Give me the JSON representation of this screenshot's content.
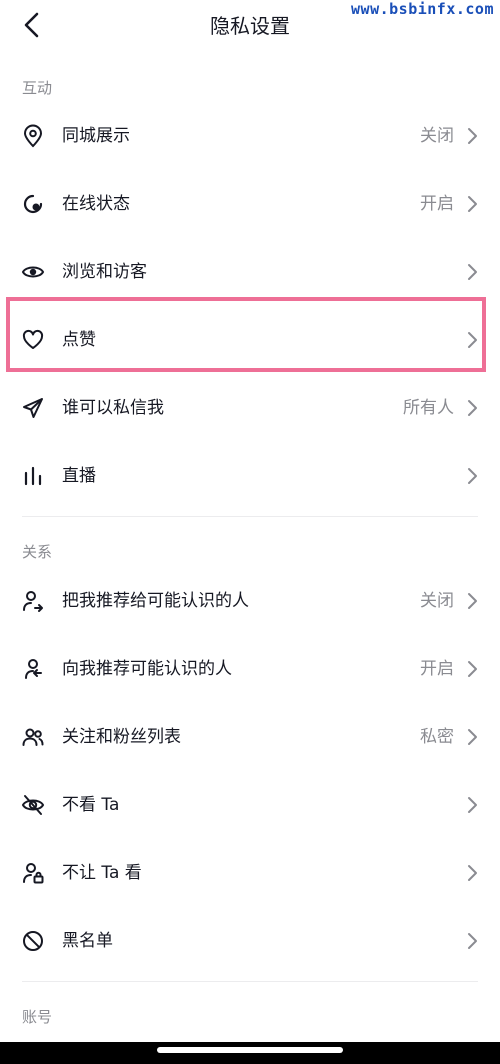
{
  "watermark": "www.bsbinfx.com",
  "header": {
    "title": "隐私设置"
  },
  "sections": [
    {
      "title": "互动",
      "items": [
        {
          "label": "同城展示",
          "value": "关闭",
          "icon": "location-pin-icon"
        },
        {
          "label": "在线状态",
          "value": "开启",
          "icon": "online-status-icon"
        },
        {
          "label": "浏览和访客",
          "value": "",
          "icon": "eye-icon"
        },
        {
          "label": "点赞",
          "value": "",
          "icon": "heart-icon"
        },
        {
          "label": "谁可以私信我",
          "value": "所有人",
          "icon": "send-icon"
        },
        {
          "label": "直播",
          "value": "",
          "icon": "live-bars-icon"
        }
      ]
    },
    {
      "title": "关系",
      "items": [
        {
          "label": "把我推荐给可能认识的人",
          "value": "关闭",
          "icon": "user-share-icon"
        },
        {
          "label": "向我推荐可能认识的人",
          "value": "开启",
          "icon": "user-recommend-icon"
        },
        {
          "label": "关注和粉丝列表",
          "value": "私密",
          "icon": "users-icon"
        },
        {
          "label": "不看 Ta",
          "value": "",
          "icon": "eye-off-icon"
        },
        {
          "label": "不让 Ta 看",
          "value": "",
          "icon": "user-lock-icon"
        },
        {
          "label": "黑名单",
          "value": "",
          "icon": "block-icon"
        }
      ]
    },
    {
      "title": "账号"
    }
  ],
  "colors": {
    "highlight": "#ee6f96",
    "text": "#161823",
    "muted": "#8a8b91",
    "watermark": "#1a4fb8"
  }
}
